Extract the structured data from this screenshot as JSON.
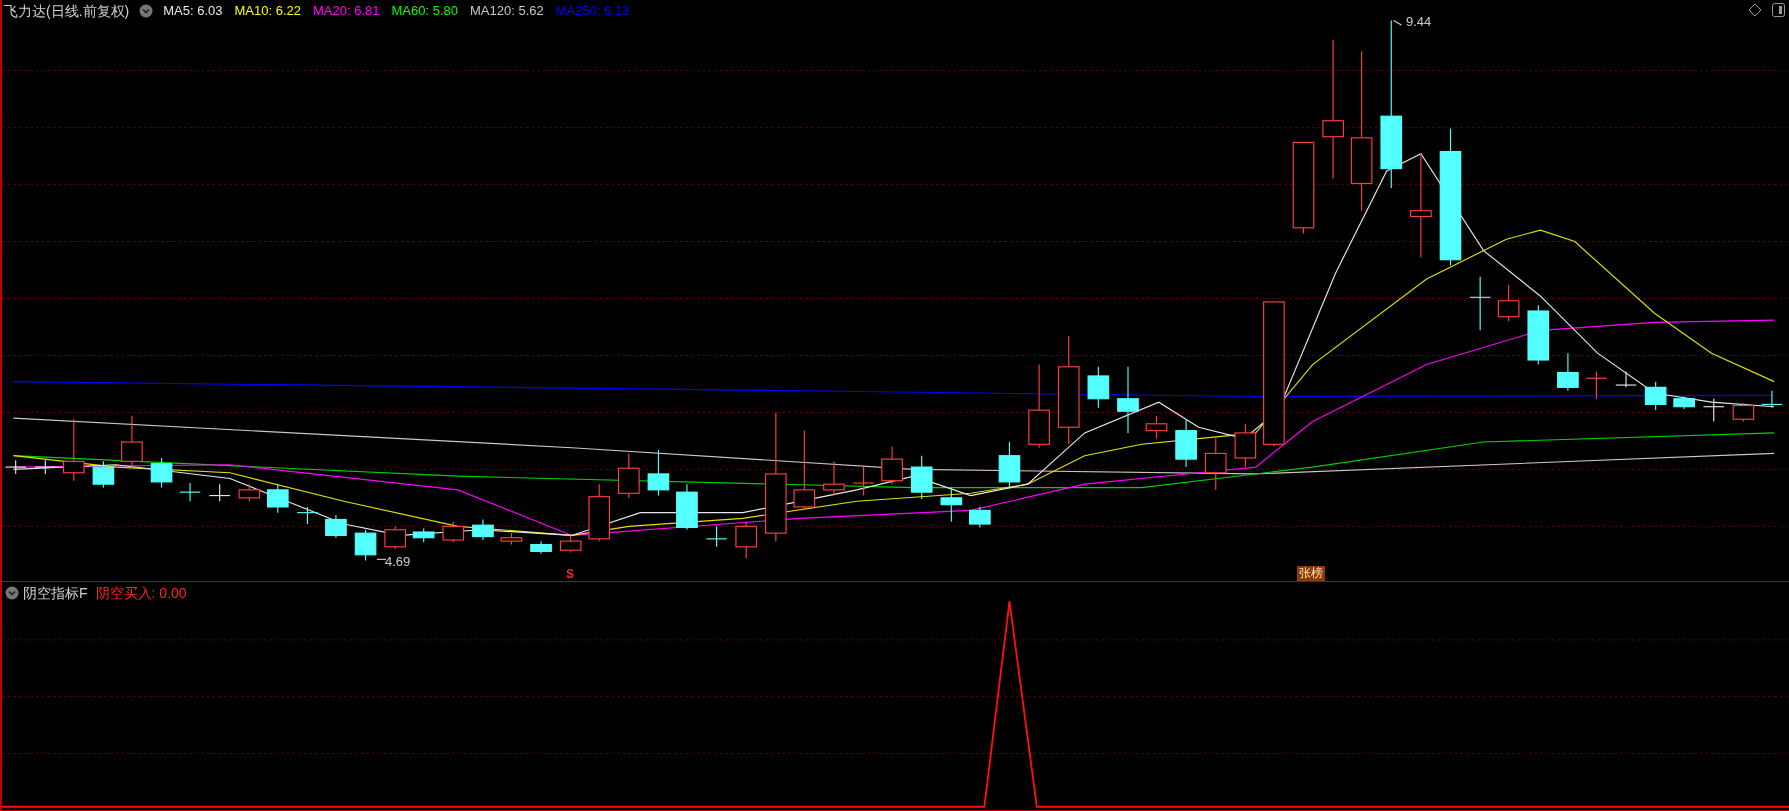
{
  "chart_title": "飞力达(日线.前复权)",
  "ma_legend": [
    {
      "label": "MA5: 6.03",
      "color": "#e8e8e8"
    },
    {
      "label": "MA10: 6.22",
      "color": "#ffff00"
    },
    {
      "label": "MA20: 6.81",
      "color": "#ff00ff"
    },
    {
      "label": "MA60: 5.80",
      "color": "#00ff00"
    },
    {
      "label": "MA120: 5.62",
      "color": "#c8c8c8"
    },
    {
      "label": "MA250: 6.13",
      "color": "#0000ff"
    }
  ],
  "high_label": "9.44",
  "low_label": "4.69",
  "markers": [
    {
      "kind": "signal",
      "text": "S"
    },
    {
      "kind": "badge",
      "text": "张榜"
    }
  ],
  "indicator": {
    "title": "阴空指标F",
    "reading": "阴空买入: 0.00"
  }
}
